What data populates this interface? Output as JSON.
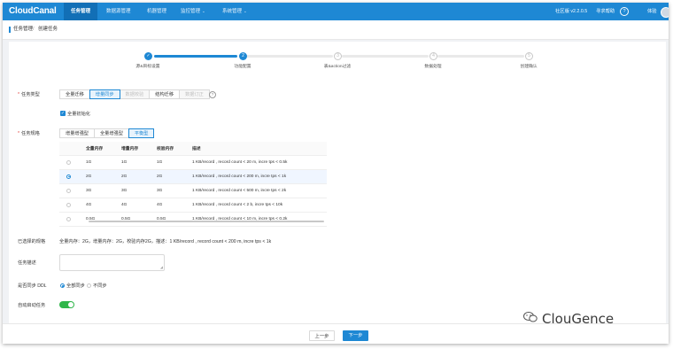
{
  "app": {
    "logo": "CloudCanal",
    "nav": [
      {
        "label": "任务管理",
        "active": true
      },
      {
        "label": "数据源管理",
        "active": false
      },
      {
        "label": "机器管理",
        "active": false
      },
      {
        "label": "监控管理",
        "active": false,
        "caret": "⌄"
      },
      {
        "label": "系统管理",
        "active": false,
        "caret": "⌄"
      }
    ],
    "version": "社区版 v2.2.0.5",
    "help": "寻求帮助",
    "help_icon": "?",
    "user": "体验"
  },
  "breadcrumb": [
    "任务管理",
    "/",
    "创建任务"
  ],
  "steps": [
    {
      "label": "源&目标设置",
      "num": "✓",
      "state": "done"
    },
    {
      "label": "功能配置",
      "num": "2",
      "state": "current"
    },
    {
      "label": "表&action过滤",
      "num": "3",
      "state": "todo"
    },
    {
      "label": "数据处理",
      "num": "4",
      "state": "todo"
    },
    {
      "label": "创建确认",
      "num": "5",
      "state": "todo"
    }
  ],
  "task_type": {
    "label": "任务类型",
    "options": [
      "全量迁移",
      "增量同步",
      "数据校验",
      "结构迁移",
      "数据订正"
    ],
    "selected": "增量同步",
    "disabled": [
      "数据校验",
      "数据订正"
    ],
    "info_icon": "?",
    "full_init_check": "✓",
    "full_init_label": "全量初始化"
  },
  "spec": {
    "label": "任务规格",
    "tabs": [
      "增量增强型",
      "全量增强型",
      "平衡型"
    ],
    "selected_tab": "平衡型",
    "columns": [
      "全量内存",
      "增量内存",
      "校验内存",
      "描述"
    ],
    "rows": [
      [
        "1G",
        "1G",
        "1G",
        "1 KB/record , record count < 20 m, incre tps < 0.5k"
      ],
      [
        "2G",
        "2G",
        "2G",
        "1 KB/record , record count < 200 m, incre tps < 1k"
      ],
      [
        "3G",
        "3G",
        "3G",
        "1 KB/record , record count < 500 m, incre tps < 2k"
      ],
      [
        "4G",
        "4G",
        "4G",
        "1 KB/record , record count < 2 b, incre tps < 10k"
      ],
      [
        "0.5G",
        "0.5G",
        "0.5G",
        "1 KB/record , record count < 10 m, incre tps < 0.2k"
      ]
    ],
    "selected_row": 1
  },
  "selected_spec": {
    "label": "已选择的规格",
    "value": "全量内存：2G，增量内存：2G，校验内存2G，描述：1 KB/record , record count < 200 m, incre tps < 1k"
  },
  "task_desc": {
    "label": "任务描述",
    "value": "",
    "resize": "◢"
  },
  "ddl": {
    "label": "是否同步 DDL",
    "options": [
      "全部同步",
      "不同步"
    ],
    "selected": "全部同步"
  },
  "auto_start": {
    "label": "自动启动任务",
    "value": true
  },
  "footer": {
    "prev": "上一步",
    "next": "下一步"
  },
  "watermark": "ClouGence"
}
